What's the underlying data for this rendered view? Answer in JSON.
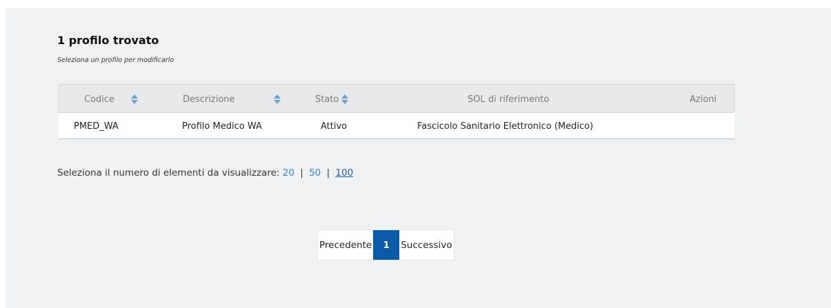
{
  "results": {
    "title": "1 profilo trovato",
    "subtitle": "Seleziona un profilo per modificarlo"
  },
  "table": {
    "columns": [
      {
        "label": "Codice",
        "sortable": true
      },
      {
        "label": "Descrizione",
        "sortable": true
      },
      {
        "label": "Stato",
        "sortable": true
      },
      {
        "label": "SOL di riferimento",
        "sortable": false
      },
      {
        "label": "Azioni",
        "sortable": false
      }
    ],
    "rows": [
      {
        "codice": "PMED_WA",
        "descrizione": "Profilo Medico WA",
        "stato": "Attivo",
        "sol": "Fascicolo Sanitario Elettronico (Medico)",
        "azioni": ""
      }
    ]
  },
  "page_size": {
    "label": "Seleziona il numero di elementi da visualizzare:",
    "options": [
      "20",
      "50",
      "100"
    ],
    "separator": "|",
    "selected": "100"
  },
  "pagination": {
    "prev_label": "Precedente",
    "current_page": "1",
    "next_label": "Successivo"
  },
  "colors": {
    "accent": "#0b5aa8",
    "link": "#2f7fd0",
    "panel_bg": "#f0f1f3",
    "sort_icon": "#6a9fd6"
  }
}
